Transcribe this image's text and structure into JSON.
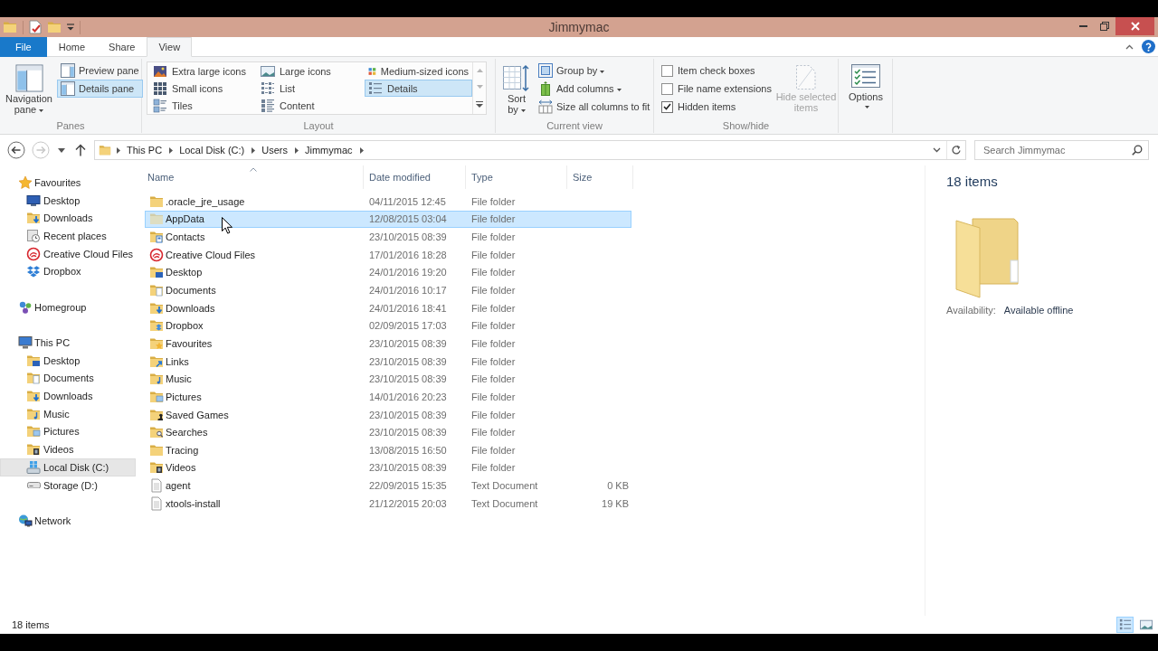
{
  "window": {
    "title": "Jimmymac"
  },
  "ribbon": {
    "tabs": [
      {
        "label": "File",
        "kind": "menu",
        "selected": false
      },
      {
        "label": "Home",
        "kind": "tab",
        "selected": false
      },
      {
        "label": "Share",
        "kind": "tab",
        "selected": false
      },
      {
        "label": "View",
        "kind": "tab",
        "selected": true
      }
    ],
    "panes": {
      "label": "Panes",
      "navigation": {
        "label": "Navigation pane",
        "menu": true
      },
      "buttons": [
        {
          "label": "Preview pane",
          "selected": false
        },
        {
          "label": "Details pane",
          "selected": true
        }
      ]
    },
    "layout": {
      "label": "Layout",
      "options": [
        {
          "label": "Extra large icons",
          "selected": false
        },
        {
          "label": "Large icons",
          "selected": false
        },
        {
          "label": "Medium-sized icons",
          "selected": false
        },
        {
          "label": "Small icons",
          "selected": false
        },
        {
          "label": "List",
          "selected": false
        },
        {
          "label": "Details",
          "selected": true
        },
        {
          "label": "Tiles",
          "selected": false
        },
        {
          "label": "Content",
          "selected": false
        }
      ]
    },
    "current_view": {
      "label": "Current view",
      "sort": {
        "label": "Sort by",
        "menu": true
      },
      "buttons": [
        {
          "label": "Group by",
          "kind": "group",
          "menu": true
        },
        {
          "label": "Add columns",
          "kind": "columns",
          "menu": true
        },
        {
          "label": "Size all columns to fit",
          "kind": "fit",
          "menu": false
        }
      ]
    },
    "show_hide": {
      "label": "Show/hide",
      "checkboxes": [
        {
          "label": "Item check boxes",
          "checked": false
        },
        {
          "label": "File name extensions",
          "checked": false
        },
        {
          "label": "Hidden items",
          "checked": true
        }
      ],
      "hide_selected": {
        "label": "Hide selected items",
        "disabled": true
      }
    },
    "options": {
      "label": "Options",
      "menu": true
    }
  },
  "address_bar": {
    "back": {
      "disabled": false
    },
    "forward": {
      "disabled": true
    },
    "crumbs": [
      "This PC",
      "Local Disk (C:)",
      "Users",
      "Jimmymac"
    ]
  },
  "search": {
    "placeholder": "Search Jimmymac"
  },
  "navigation": [
    {
      "label": "Favourites",
      "kind": "star",
      "selected": false,
      "children": [
        {
          "label": "Desktop",
          "kind": "screen",
          "selected": false
        },
        {
          "label": "Downloads",
          "kind": "downloads",
          "selected": false
        },
        {
          "label": "Recent places",
          "kind": "recent",
          "selected": false
        },
        {
          "label": "Creative Cloud Files",
          "kind": "cloud",
          "selected": false
        },
        {
          "label": "Dropbox",
          "kind": "dropbox",
          "selected": false
        }
      ]
    },
    {
      "label": "Homegroup",
      "kind": "homegroup",
      "selected": false
    },
    {
      "label": "This PC",
      "kind": "computer",
      "selected": false,
      "children": [
        {
          "label": "Desktop",
          "kind": "desktop",
          "selected": false
        },
        {
          "label": "Documents",
          "kind": "documents",
          "selected": false
        },
        {
          "label": "Downloads",
          "kind": "downloads",
          "selected": false
        },
        {
          "label": "Music",
          "kind": "music",
          "selected": false
        },
        {
          "label": "Pictures",
          "kind": "pictures",
          "selected": false
        },
        {
          "label": "Videos",
          "kind": "videos",
          "selected": false
        },
        {
          "label": "Local Disk (C:)",
          "kind": "drive",
          "selected": true
        },
        {
          "label": "Storage (D:)",
          "kind": "storage",
          "selected": false
        }
      ]
    },
    {
      "label": "Network",
      "kind": "network",
      "selected": false
    }
  ],
  "file_list": {
    "columns": [
      {
        "label": "Name",
        "sorted": true
      },
      {
        "label": "Date modified",
        "sorted": false
      },
      {
        "label": "Type",
        "sorted": false
      },
      {
        "label": "Size",
        "sorted": false
      }
    ],
    "rows": [
      {
        "name": ".oracle_jre_usage",
        "date": "04/11/2015 12:45",
        "type": "File folder",
        "kind": "folder",
        "selected": false
      },
      {
        "name": "AppData",
        "date": "12/08/2015 03:04",
        "type": "File folder",
        "kind": "hidden",
        "selected": true
      },
      {
        "name": "Contacts",
        "date": "23/10/2015 08:39",
        "type": "File folder",
        "kind": "contacts",
        "selected": false
      },
      {
        "name": "Creative Cloud Files",
        "date": "17/01/2016 18:28",
        "type": "File folder",
        "kind": "cloud",
        "selected": false
      },
      {
        "name": "Desktop",
        "date": "24/01/2016 19:20",
        "type": "File folder",
        "kind": "desktop",
        "selected": false
      },
      {
        "name": "Documents",
        "date": "24/01/2016 10:17",
        "type": "File folder",
        "kind": "documents",
        "selected": false
      },
      {
        "name": "Downloads",
        "date": "24/01/2016 18:41",
        "type": "File folder",
        "kind": "downloads",
        "selected": false
      },
      {
        "name": "Dropbox",
        "date": "02/09/2015 17:03",
        "type": "File folder",
        "kind": "dropboxfolder",
        "selected": false
      },
      {
        "name": "Favourites",
        "date": "23/10/2015 08:39",
        "type": "File folder",
        "kind": "favourites",
        "selected": false
      },
      {
        "name": "Links",
        "date": "23/10/2015 08:39",
        "type": "File folder",
        "kind": "links",
        "selected": false
      },
      {
        "name": "Music",
        "date": "23/10/2015 08:39",
        "type": "File folder",
        "kind": "music",
        "selected": false
      },
      {
        "name": "Pictures",
        "date": "14/01/2016 20:23",
        "type": "File folder",
        "kind": "pictures",
        "selected": false
      },
      {
        "name": "Saved Games",
        "date": "23/10/2015 08:39",
        "type": "File folder",
        "kind": "games",
        "selected": false
      },
      {
        "name": "Searches",
        "date": "23/10/2015 08:39",
        "type": "File folder",
        "kind": "searches",
        "selected": false
      },
      {
        "name": "Tracing",
        "date": "13/08/2015 16:50",
        "type": "File folder",
        "kind": "folder",
        "selected": false
      },
      {
        "name": "Videos",
        "date": "23/10/2015 08:39",
        "type": "File folder",
        "kind": "videos",
        "selected": false
      },
      {
        "name": "agent",
        "date": "22/09/2015 15:35",
        "type": "Text Document",
        "size": "0 KB",
        "kind": "text",
        "selected": false
      },
      {
        "name": "xtools-install",
        "date": "21/12/2015 20:03",
        "type": "Text Document",
        "size": "19 KB",
        "kind": "text",
        "selected": false
      }
    ]
  },
  "details_pane": {
    "count": "18 items",
    "availability_label": "Availability:",
    "availability": "Available offline"
  },
  "status_bar": {
    "count": "18 items",
    "views": [
      {
        "kind": "details",
        "selected": true
      },
      {
        "kind": "thumbnails",
        "selected": false
      }
    ]
  }
}
